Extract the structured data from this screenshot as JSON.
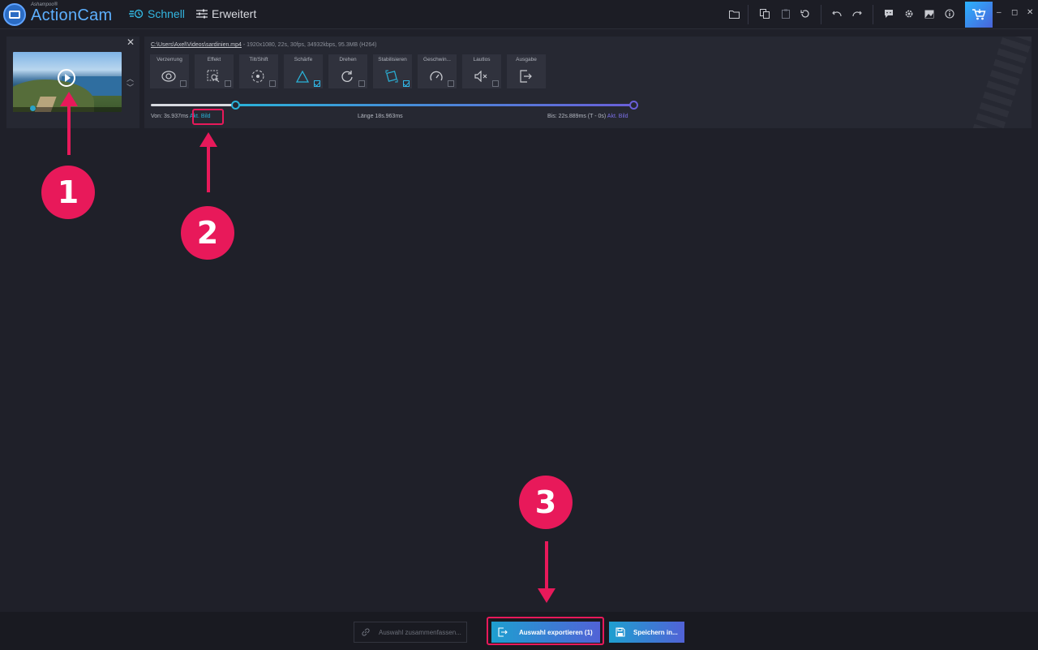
{
  "app": {
    "brand_small": "Ashampoo®",
    "brand": "ActionCam",
    "modes": [
      "Schnell",
      "Erweitert"
    ],
    "window_controls": [
      "–",
      "◻",
      "✕"
    ],
    "accent": "#2ab2d8",
    "annotation_color": "#e8195a"
  },
  "toolbar_icons": [
    "folder-icon",
    "copy-icon",
    "paste-icon",
    "reset-icon",
    "undo-icon",
    "redo-icon",
    "chat-icon",
    "settings-icon",
    "image-icon",
    "info-icon",
    "cart-icon"
  ],
  "clip": {
    "close": "✕",
    "up": "︿",
    "down": "﹀"
  },
  "editor": {
    "filename": "C:\\Users\\Axel\\Videos\\sardinien.mp4",
    "meta": " -   1920x1080, 22s, 30fps, 34932kbps, 95.3MB (H264)",
    "tools": [
      {
        "label": "Verzerrung",
        "icon": "lens-icon",
        "checked": false
      },
      {
        "label": "Effekt",
        "icon": "effect-icon",
        "checked": false
      },
      {
        "label": "Tilt/Shift",
        "icon": "tiltshift-icon",
        "checked": false
      },
      {
        "label": "Schärfe",
        "icon": "sharpness-icon",
        "checked": true
      },
      {
        "label": "Drehen",
        "icon": "rotate-icon",
        "checked": false
      },
      {
        "label": "Stabilisieren",
        "icon": "stabilize-icon",
        "checked": true
      },
      {
        "label": "Geschwin...",
        "icon": "speed-icon",
        "checked": false
      },
      {
        "label": "Lautlos",
        "icon": "mute-icon",
        "checked": false
      },
      {
        "label": "Ausgabe",
        "icon": "output-icon",
        "checked": null
      }
    ],
    "from_label": "Von: 3s.937ms",
    "from_link": "Akt. Bild",
    "length_label": "Länge 18s.963ms",
    "to_label": "Bis: 22s.889ms (T - 0s)",
    "to_link": "Akt. Bild"
  },
  "annotations": [
    "1",
    "2",
    "3"
  ],
  "bottom": {
    "merge": "Auswahl zusammenfassen...",
    "export": "Auswahl exportieren (1)",
    "save": "Speichern in..."
  }
}
